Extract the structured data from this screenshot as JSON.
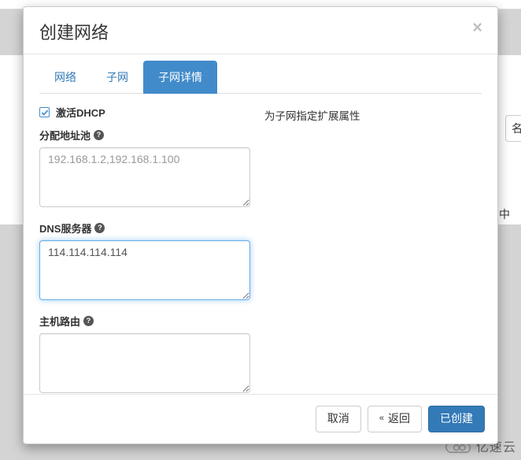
{
  "modal": {
    "title": "创建网络",
    "close_symbol": "×"
  },
  "tabs": [
    {
      "label": "网络",
      "active": false
    },
    {
      "label": "子网",
      "active": false
    },
    {
      "label": "子网详情",
      "active": true
    }
  ],
  "form": {
    "dhcp_checkbox_label": "激活DHCP",
    "dhcp_checked": true,
    "allocation_pools": {
      "label": "分配地址池",
      "placeholder": "192.168.1.2,192.168.1.100",
      "value": ""
    },
    "dns_servers": {
      "label": "DNS服务器",
      "value": "114.114.114.114"
    },
    "host_routes": {
      "label": "主机路由",
      "value": ""
    }
  },
  "description_text": "为子网指定扩展属性",
  "footer": {
    "cancel": "取消",
    "back": "返回",
    "back_icon": "«",
    "submit": "已创建"
  },
  "background": {
    "button_frag": "名",
    "text_frag": "中",
    "logo_text": "亿速云"
  }
}
